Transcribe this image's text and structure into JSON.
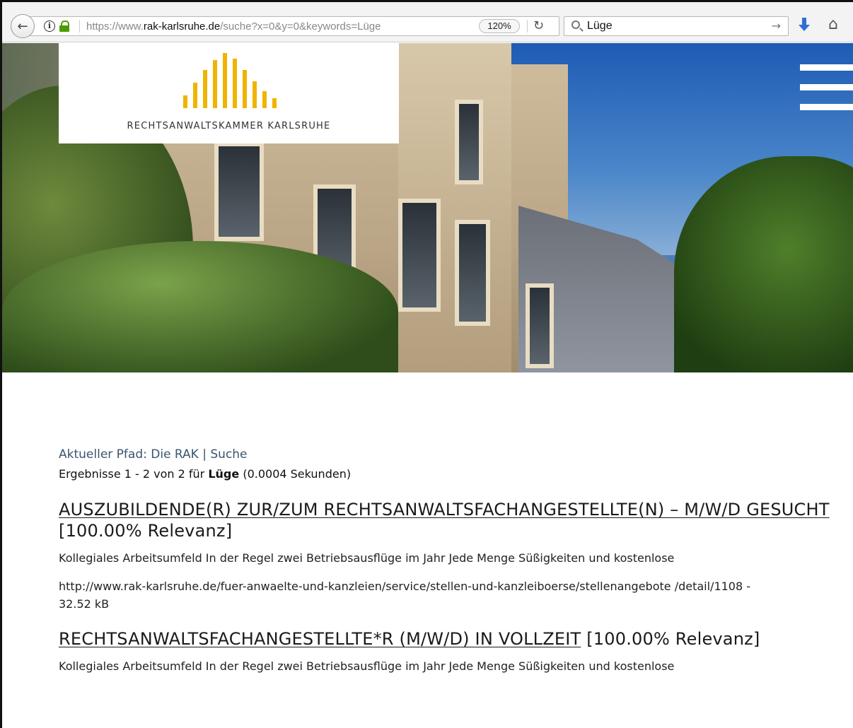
{
  "browser": {
    "url_prefix": "https://www.",
    "url_host": "rak-karlsruhe.de",
    "url_path": "/suche?x=0&y=0&keywords=Lüge",
    "zoom": "120%",
    "search_query": "Lüge"
  },
  "header": {
    "logo_text": "RECHTSANWALTSKAMMER KARLSRUHE",
    "brand_color": "#f0b400"
  },
  "breadcrumb": {
    "label": "Aktueller Pfad:",
    "items": [
      "Die RAK",
      "Suche"
    ],
    "separator": "|"
  },
  "results_summary": {
    "prefix": "Ergebnisse 1 - 2 von 2 für",
    "keyword": "Lüge",
    "suffix": "(0.0004 Sekunden)"
  },
  "results": [
    {
      "title": "AUSZUBILDENDE(R) ZUR/ZUM RECHTSANWALTSFACHANGESTELLTE(N) – M/W/D GESUCHT",
      "relevance": "[100.00% Relevanz]",
      "snippet": "Kollegiales Arbeitsumfeld In der Regel zwei Betriebsausflüge im Jahr Jede Menge Süßigkeiten und kostenlose",
      "url": "http://www.rak-karlsruhe.de/fuer-anwaelte-und-kanzleien/service/stellen-und-kanzleiboerse/stellenangebote /detail/1108 - 32.52 kB"
    },
    {
      "title": "RECHTSANWALTSFACHANGESTELLTE*R (M/W/D) IN VOLLZEIT",
      "relevance": "[100.00% Relevanz]",
      "snippet": "Kollegiales Arbeitsumfeld In der Regel zwei Betriebsausflüge im Jahr Jede Menge Süßigkeiten und kostenlose"
    }
  ]
}
